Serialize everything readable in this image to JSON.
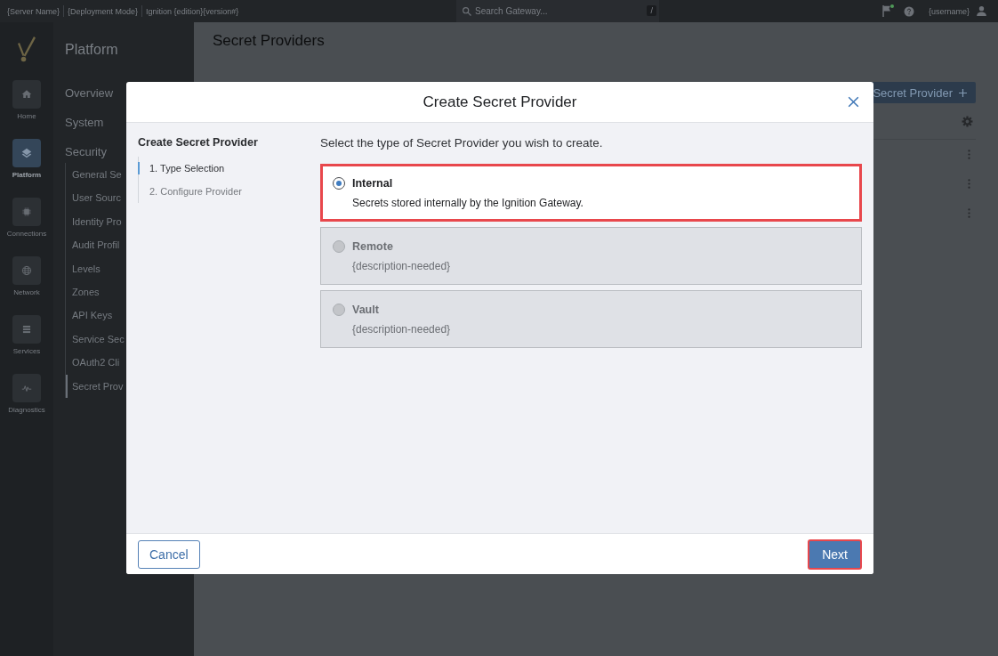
{
  "top_bar": {
    "server_name": "{Server Name}",
    "deployment_mode": "{Deployment Mode}",
    "product": "Ignition {edition}{version#}",
    "search": {
      "placeholder": "Search Gateway...",
      "shortcut": "/"
    },
    "username": "{username}"
  },
  "rail": [
    {
      "label": "Home",
      "kind": "home",
      "selected": false
    },
    {
      "label": "Platform",
      "kind": "platform",
      "selected": true
    },
    {
      "label": "Connections",
      "kind": "connections",
      "selected": false
    },
    {
      "label": "Network",
      "kind": "network",
      "selected": false
    },
    {
      "label": "Services",
      "kind": "services",
      "selected": false
    },
    {
      "label": "Diagnostics",
      "kind": "diagnostics",
      "selected": false
    }
  ],
  "nav": {
    "title": "Platform",
    "items": [
      {
        "label": "Overview",
        "selected": false
      },
      {
        "label": "System",
        "selected": false
      },
      {
        "label": "Security",
        "selected": false,
        "children": [
          {
            "label": "General Se",
            "selected": false
          },
          {
            "label": "User Sourc",
            "selected": false
          },
          {
            "label": "Identity Pro",
            "selected": false
          },
          {
            "label": "Audit Profil",
            "selected": false
          },
          {
            "label": "Levels",
            "selected": false
          },
          {
            "label": "Zones",
            "selected": false
          },
          {
            "label": "API Keys",
            "selected": false
          },
          {
            "label": "Service Sec",
            "selected": false
          },
          {
            "label": "OAuth2 Cli",
            "selected": false
          },
          {
            "label": "Secret Prov",
            "selected": true
          }
        ]
      }
    ]
  },
  "main": {
    "title": "Secret Providers",
    "create_button": {
      "label": "Secret Provider"
    }
  },
  "modal": {
    "title": "Create Secret Provider",
    "steps_title": "Create Secret Provider",
    "steps": [
      {
        "label": "1. Type Selection",
        "selected": true
      },
      {
        "label": "2. Configure Provider",
        "selected": false
      }
    ],
    "prompt": "Select the type of Secret Provider you wish to create.",
    "options": [
      {
        "label": "Internal",
        "description": "Secrets stored internally by the Ignition Gateway.",
        "selected": true,
        "disabled": false,
        "highlighted": true
      },
      {
        "label": "Remote",
        "description": "{description-needed}",
        "selected": false,
        "disabled": true,
        "highlighted": false
      },
      {
        "label": "Vault",
        "description": "{description-needed}",
        "selected": false,
        "disabled": true,
        "highlighted": false
      }
    ],
    "buttons": [
      {
        "label": "Cancel",
        "kind": "secondary",
        "highlighted": false
      },
      {
        "label": "Next",
        "kind": "primary",
        "highlighted": true
      }
    ]
  }
}
